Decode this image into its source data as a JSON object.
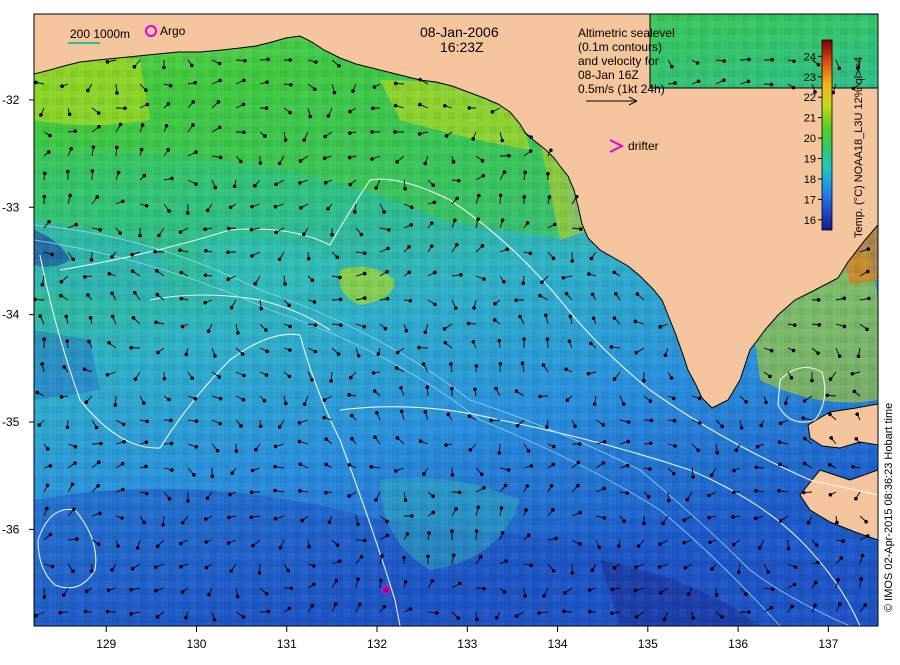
{
  "title": {
    "date": "08-Jan-2006",
    "time": "16:23Z"
  },
  "legend": {
    "isobaths": "200  1000m",
    "argo": "Argo",
    "drifter": "drifter",
    "altimetry_lines": [
      "Altimetric sealevel",
      "(0.1m contours)",
      "and velocity for",
      "08-Jan 16Z",
      "0.5m/s (1kt 24h)"
    ]
  },
  "axes": {
    "x_ticks": [
      "129",
      "130",
      "131",
      "132",
      "133",
      "134",
      "135",
      "136",
      "137"
    ],
    "y_ticks": [
      "-32",
      "-33",
      "-34",
      "-35",
      "-36"
    ],
    "lon_range": [
      128.2,
      137.55
    ],
    "lat_range": [
      -31.2,
      -36.9
    ]
  },
  "colorbar": {
    "label": "Temp. (°C) NOAA18_L3U 12% ql>=4",
    "ticks": [
      "16",
      "17",
      "18",
      "19",
      "20",
      "21",
      "22",
      "23",
      "24"
    ],
    "range": [
      15.5,
      24.8
    ],
    "colors": [
      "#1a1a80",
      "#1e50d0",
      "#2090e8",
      "#20c8c0",
      "#30c860",
      "#60d020",
      "#c8d820",
      "#f0b418",
      "#e05010",
      "#800000"
    ]
  },
  "credit": "© IMOS 02-Apr-2015 08:36:23 Hobart time",
  "colors": {
    "land": "#f5c69e",
    "ocean_warm": "#30c850",
    "ocean_cool": "#2a8ad8",
    "contour": "#ffffff",
    "argo_marker": "#e000e0"
  }
}
